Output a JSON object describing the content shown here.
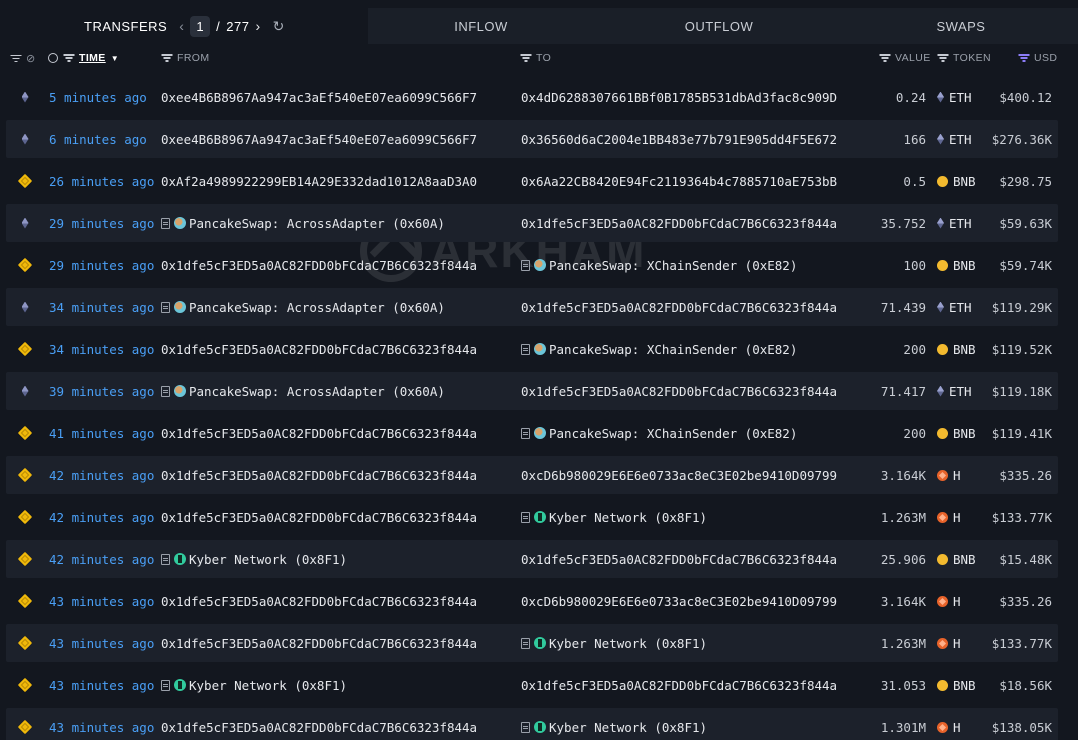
{
  "header": {
    "tab_transfers": "TRANSFERS",
    "page_current": "1",
    "page_separator": "/",
    "page_total": "277",
    "tab_inflow": "INFLOW",
    "tab_outflow": "OUTFLOW",
    "tab_swaps": "SWAPS"
  },
  "columns": {
    "time": "TIME",
    "from": "FROM",
    "to": "TO",
    "value": "VALUE",
    "token": "TOKEN",
    "usd": "USD"
  },
  "watermark": "ARKHAM",
  "icons": {
    "chain_eth": "ethereum-chain-icon",
    "chain_bnb": "bnb-chain-icon",
    "doc": "contract-doc-icon",
    "pancake": "pancakeswap-logo-icon",
    "kyber": "kyber-logo-icon"
  },
  "colors": {
    "background": "#13171f",
    "time_link": "#4a9ff5",
    "bnb": "#f3ba2f",
    "h_token": "#e8632a",
    "accent_purple": "#8b7cf6"
  },
  "rows": [
    {
      "chain": "eth",
      "time": "5 minutes ago",
      "from": "0xee4B6B8967Aa947ac3aEf540eE07ea6099C566F7",
      "from_entity": "",
      "to": "0x4dD6288307661BBf0B1785B531dbAd3fac8c909D",
      "to_entity": "",
      "value": "0.24",
      "token": "ETH",
      "usd": "$400.12"
    },
    {
      "chain": "eth",
      "time": "6 minutes ago",
      "from": "0xee4B6B8967Aa947ac3aEf540eE07ea6099C566F7",
      "from_entity": "",
      "to": "0x36560d6aC2004e1BB483e77b791E905dd4F5E672",
      "to_entity": "",
      "value": "166",
      "token": "ETH",
      "usd": "$276.36K"
    },
    {
      "chain": "bnb",
      "time": "26 minutes ago",
      "from": "0xAf2a4989922299EB14A29E332dad1012A8aaD3A0",
      "from_entity": "",
      "to": "0x6Aa22CB8420E94Fc2119364b4c7885710aE753bB",
      "to_entity": "",
      "value": "0.5",
      "token": "BNB",
      "usd": "$298.75"
    },
    {
      "chain": "eth",
      "time": "29 minutes ago",
      "from": "PancakeSwap: AcrossAdapter (0x60A)",
      "from_entity": "pancake",
      "to": "0x1dfe5cF3ED5a0AC82FDD0bFCdaC7B6C6323f844a",
      "to_entity": "",
      "value": "35.752",
      "token": "ETH",
      "usd": "$59.63K"
    },
    {
      "chain": "bnb",
      "time": "29 minutes ago",
      "from": "0x1dfe5cF3ED5a0AC82FDD0bFCdaC7B6C6323f844a",
      "from_entity": "",
      "to": "PancakeSwap: XChainSender (0xE82)",
      "to_entity": "pancake",
      "value": "100",
      "token": "BNB",
      "usd": "$59.74K"
    },
    {
      "chain": "eth",
      "time": "34 minutes ago",
      "from": "PancakeSwap: AcrossAdapter (0x60A)",
      "from_entity": "pancake",
      "to": "0x1dfe5cF3ED5a0AC82FDD0bFCdaC7B6C6323f844a",
      "to_entity": "",
      "value": "71.439",
      "token": "ETH",
      "usd": "$119.29K"
    },
    {
      "chain": "bnb",
      "time": "34 minutes ago",
      "from": "0x1dfe5cF3ED5a0AC82FDD0bFCdaC7B6C6323f844a",
      "from_entity": "",
      "to": "PancakeSwap: XChainSender (0xE82)",
      "to_entity": "pancake",
      "value": "200",
      "token": "BNB",
      "usd": "$119.52K"
    },
    {
      "chain": "eth",
      "time": "39 minutes ago",
      "from": "PancakeSwap: AcrossAdapter (0x60A)",
      "from_entity": "pancake",
      "to": "0x1dfe5cF3ED5a0AC82FDD0bFCdaC7B6C6323f844a",
      "to_entity": "",
      "value": "71.417",
      "token": "ETH",
      "usd": "$119.18K"
    },
    {
      "chain": "bnb",
      "time": "41 minutes ago",
      "from": "0x1dfe5cF3ED5a0AC82FDD0bFCdaC7B6C6323f844a",
      "from_entity": "",
      "to": "PancakeSwap: XChainSender (0xE82)",
      "to_entity": "pancake",
      "value": "200",
      "token": "BNB",
      "usd": "$119.41K"
    },
    {
      "chain": "bnb",
      "time": "42 minutes ago",
      "from": "0x1dfe5cF3ED5a0AC82FDD0bFCdaC7B6C6323f844a",
      "from_entity": "",
      "to": "0xcD6b980029E6E6e0733ac8eC3E02be9410D09799",
      "to_entity": "",
      "value": "3.164K",
      "token": "H",
      "usd": "$335.26"
    },
    {
      "chain": "bnb",
      "time": "42 minutes ago",
      "from": "0x1dfe5cF3ED5a0AC82FDD0bFCdaC7B6C6323f844a",
      "from_entity": "",
      "to": "Kyber Network (0x8F1)",
      "to_entity": "kyber",
      "value": "1.263M",
      "token": "H",
      "usd": "$133.77K"
    },
    {
      "chain": "bnb",
      "time": "42 minutes ago",
      "from": "Kyber Network (0x8F1)",
      "from_entity": "kyber",
      "to": "0x1dfe5cF3ED5a0AC82FDD0bFCdaC7B6C6323f844a",
      "to_entity": "",
      "value": "25.906",
      "token": "BNB",
      "usd": "$15.48K"
    },
    {
      "chain": "bnb",
      "time": "43 minutes ago",
      "from": "0x1dfe5cF3ED5a0AC82FDD0bFCdaC7B6C6323f844a",
      "from_entity": "",
      "to": "0xcD6b980029E6E6e0733ac8eC3E02be9410D09799",
      "to_entity": "",
      "value": "3.164K",
      "token": "H",
      "usd": "$335.26"
    },
    {
      "chain": "bnb",
      "time": "43 minutes ago",
      "from": "0x1dfe5cF3ED5a0AC82FDD0bFCdaC7B6C6323f844a",
      "from_entity": "",
      "to": "Kyber Network (0x8F1)",
      "to_entity": "kyber",
      "value": "1.263M",
      "token": "H",
      "usd": "$133.77K"
    },
    {
      "chain": "bnb",
      "time": "43 minutes ago",
      "from": "Kyber Network (0x8F1)",
      "from_entity": "kyber",
      "to": "0x1dfe5cF3ED5a0AC82FDD0bFCdaC7B6C6323f844a",
      "to_entity": "",
      "value": "31.053",
      "token": "BNB",
      "usd": "$18.56K"
    },
    {
      "chain": "bnb",
      "time": "43 minutes ago",
      "from": "0x1dfe5cF3ED5a0AC82FDD0bFCdaC7B6C6323f844a",
      "from_entity": "",
      "to": "Kyber Network (0x8F1)",
      "to_entity": "kyber",
      "value": "1.301M",
      "token": "H",
      "usd": "$138.05K"
    }
  ]
}
